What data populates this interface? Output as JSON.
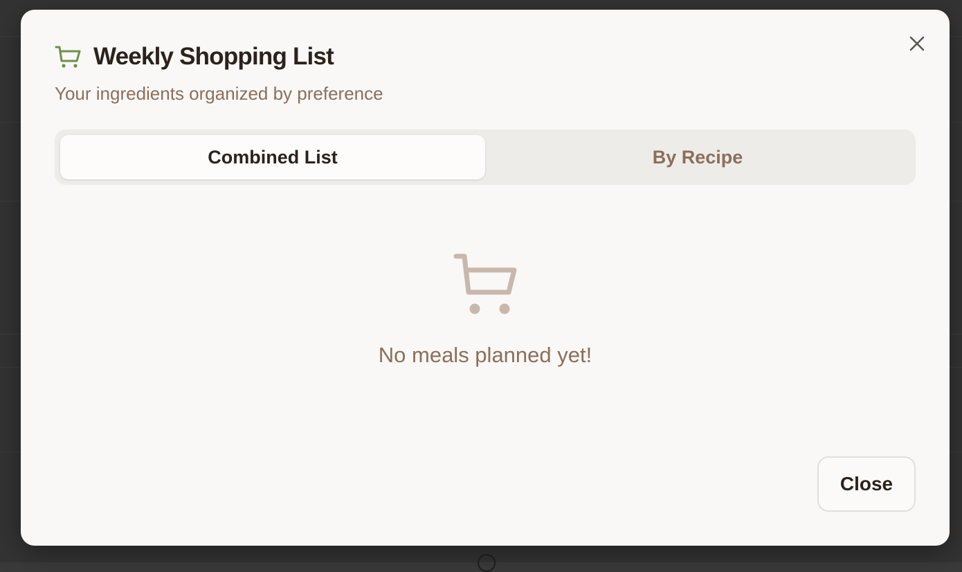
{
  "dialog": {
    "title": "Weekly Shopping List",
    "subtitle": "Your ingredients organized by preference",
    "title_icon": "shopping-cart-icon",
    "close_icon": "close-icon"
  },
  "tabs": [
    {
      "label": "Combined List",
      "active": true
    },
    {
      "label": "By Recipe",
      "active": false
    }
  ],
  "empty_state": {
    "icon": "shopping-cart-icon",
    "message": "No meals planned yet!"
  },
  "footer": {
    "close_label": "Close"
  },
  "colors": {
    "accent_green": "#6f8f4e",
    "muted_brown": "#8b6f5c",
    "empty_icon": "#c8b8ac",
    "dialog_bg": "#f9f8f6"
  }
}
